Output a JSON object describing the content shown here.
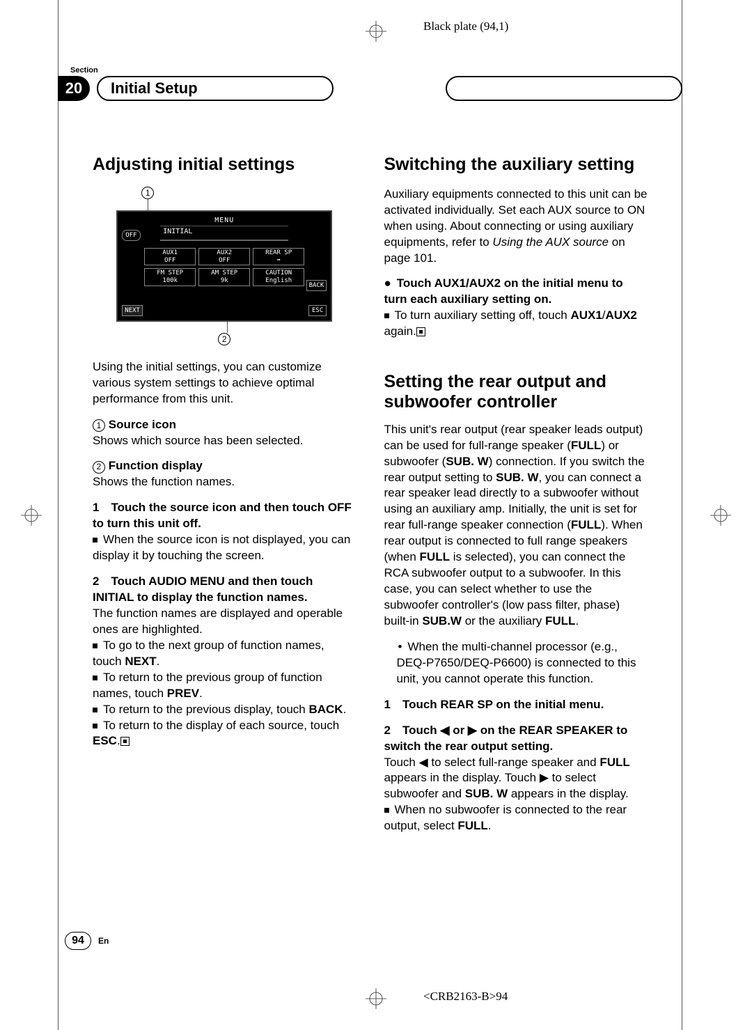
{
  "plate": "Black plate (94,1)",
  "section_label": "Section",
  "section_number": "20",
  "section_title": "Initial Setup",
  "left": {
    "h2": "Adjusting initial settings",
    "callout1": "1",
    "callout2": "2",
    "screen": {
      "off": "OFF",
      "menu": "MENU",
      "initial": "INITIAL",
      "btns": [
        {
          "t": "AUX1",
          "s": "OFF"
        },
        {
          "t": "AUX2",
          "s": "OFF"
        },
        {
          "t": "REAR SP",
          "s": "➡"
        },
        {
          "t": "FM STEP",
          "s": "100k"
        },
        {
          "t": "AM STEP",
          "s": "9k"
        },
        {
          "t": "CAUTION",
          "s": "English"
        }
      ],
      "back": "BACK",
      "next": "NEXT",
      "esc": "ESC"
    },
    "intro": "Using the initial settings, you can customize various system settings to achieve optimal performance from this unit.",
    "c1_head": "Source icon",
    "c1_body": "Shows which source has been selected.",
    "c2_head": "Function display",
    "c2_body": "Shows the function names.",
    "s1_head_a": "1 Touch the source icon and then touch OFF to turn this unit off.",
    "s1_b1": "When the source icon is not displayed, you can display it by touching the screen.",
    "s2_head": "2 Touch AUDIO MENU and then touch INITIAL to display the function names.",
    "s2_body": "The function names are displayed and operable ones are highlighted.",
    "s2_b1_a": "To go to the next group of function names, touch ",
    "s2_b1_b": "NEXT",
    "s2_b2_a": "To return to the previous group of function names, touch ",
    "s2_b2_b": "PREV",
    "s2_b3_a": "To return to the previous display, touch ",
    "s2_b3_b": "BACK",
    "s2_b4_a": "To return to the display of each source, touch ",
    "s2_b4_b": "ESC"
  },
  "right": {
    "h2a": "Switching the auxiliary setting",
    "aux_intro_a": "Auxiliary equipments connected to this unit can be activated individually. Set each AUX source to ON when using. About connecting or using auxiliary equipments, refer to ",
    "aux_intro_i": "Using the AUX source",
    "aux_intro_b": " on page 101.",
    "aux_lead": "Touch AUX1/AUX2 on the initial menu to turn each auxiliary setting on.",
    "aux_b1_a": "To turn auxiliary setting off, touch ",
    "aux_b1_b": "AUX1",
    "aux_b1_c": "/",
    "aux_b1_d": "AUX2",
    "aux_b1_e": " again.",
    "h2b": "Setting the rear output and subwoofer controller",
    "rear_p_a": "This unit's rear output (rear speaker leads output) can be used for full-range speaker (",
    "rear_full": "FULL",
    "rear_p_b": ") or subwoofer (",
    "rear_subw": "SUB. W",
    "rear_p_c": ") connection. If you switch the rear output setting to ",
    "rear_p_d": ", you can connect a rear speaker lead directly to a subwoofer without using an auxiliary amp. Initially, the unit is set for rear full-range speaker connection (",
    "rear_p_e": "). When rear output is connected to full range speakers (when ",
    "rear_p_f": " is selected), you can connect the RCA subwoofer output to a subwoofer. In this case, you can select whether to use the subwoofer controller's (low pass filter, phase) built-in ",
    "rear_subw2": "SUB.W",
    "rear_p_g": " or the auxiliary ",
    "rear_note": "When the multi-channel processor (e.g., DEQ-P7650/DEQ-P6600) is connected to this unit, you cannot operate this function.",
    "rear_s1": "1 Touch REAR SP on the initial menu.",
    "rear_s2": "2 Touch ◀ or ▶ on the REAR SPEAKER to switch the rear output setting.",
    "rear_s2_body_a": "Touch ◀ to select full-range speaker and ",
    "rear_s2_body_b": " appears in the display. Touch ▶ to select subwoofer and ",
    "rear_s2_body_c": " appears in the display.",
    "rear_b1_a": "When no subwoofer is connected to the rear output, select ",
    "rear_b1_b": "FULL"
  },
  "footer": {
    "page": "94",
    "lang": "En"
  },
  "doc_code": "<CRB2163-B>94"
}
